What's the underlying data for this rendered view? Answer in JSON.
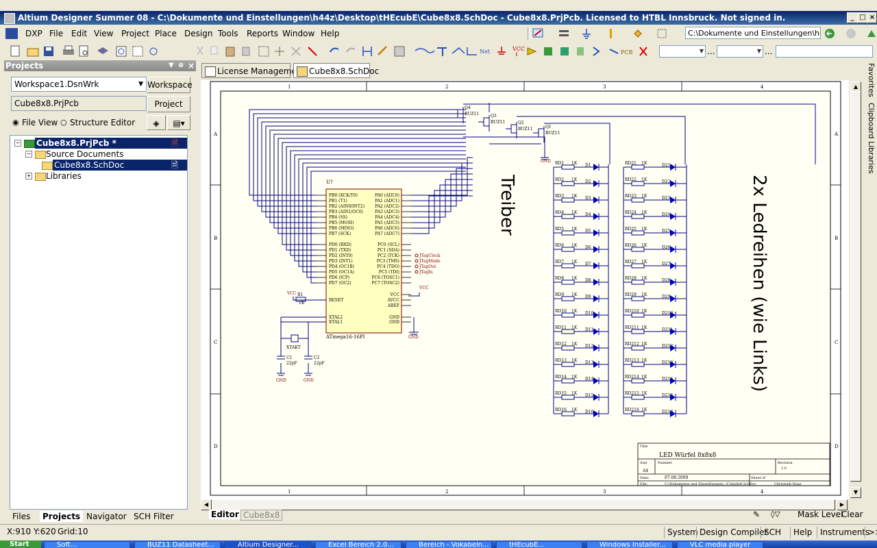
{
  "window": {
    "title": "Altium Designer Summer 08 - C:\\Dokumente und Einstellungen\\h44z\\Desktop\\tHEcubE\\Cube8x8.SchDoc - Cube8x8.PrjPcb. Licensed to HTBL Innsbruck. Not signed in.",
    "min": "_",
    "max": "□",
    "close": "×"
  },
  "menu": [
    "DXP",
    "File",
    "Edit",
    "View",
    "Project",
    "Place",
    "Design",
    "Tools",
    "Reports",
    "Window",
    "Help"
  ],
  "path_combo": "C:\\Dokumente und Einstellungen\\h44z",
  "projects_panel": {
    "title": "Projects",
    "workspace_value": "Workspace1.DsnWrk",
    "workspace_button": "Workspace",
    "project_value": "Cube8x8.PrjPcb",
    "project_button": "Project",
    "radio_file_view": "File View",
    "radio_structure": "Structure Editor",
    "tree": {
      "project": "Cube8x8.PrjPcb *",
      "source_documents": "Source Documents",
      "schdoc": "Cube8x8.SchDoc",
      "libraries": "Libraries"
    }
  },
  "panel_tabs": [
    "Files",
    "Projects",
    "Navigator",
    "SCH Filter"
  ],
  "doc_tabs": [
    "License Management",
    "Cube8x8.SchDoc"
  ],
  "right_strip": [
    "Favorites",
    "Clipboard",
    "Libraries"
  ],
  "editor_tabs": {
    "editor": "Editor",
    "doc": "Cube8x8"
  },
  "mask_level": "Mask Level",
  "clear": "Clear",
  "status": {
    "coords": "X:910 Y:620",
    "grid": "Grid:10",
    "system": "System",
    "design_compiler": "Design Compiler",
    "sch": "SCH",
    "help": "Help",
    "instruments": "Instruments",
    "more": ">>"
  },
  "taskbar": [
    "Start",
    "Soft...",
    "BUZ11 Datasheet...",
    "Altium Designer...",
    "Excel Bereich 2.0...",
    "Bereich - Vokabeln...",
    "tHEcubE...",
    "Windows Installer...",
    "VLC media player"
  ],
  "schematic": {
    "col_labels": [
      "1",
      "2",
      "3",
      "4"
    ],
    "row_labels": [
      "A",
      "B",
      "C",
      "D"
    ],
    "text_treiber": "Treiber",
    "text_ledreihen": "2x Ledreihen (wie Links)",
    "mcu": {
      "designator": "U?",
      "name": "ATmega16-16PI",
      "left_pins": [
        "PB0 (XCK/T0)",
        "PB1 (T1)",
        "PB2 (AIN0/INT2)",
        "PB3 (AIN1/OC0)",
        "PB4 (SS)",
        "PB5 (MOSI)",
        "PB6 (MISO)",
        "PB7 (SCK)",
        "PD0 (RXD)",
        "PD1 (TXD)",
        "PD2 (INT0)",
        "PD3 (INT1)",
        "PD4 (OC1B)",
        "PD5 (OC1A)",
        "PD6 (ICP)",
        "PD7 (OC2)",
        "RESET",
        "XTAL2",
        "XTAL1"
      ],
      "right_pins": [
        "PA0 (ADC0)",
        "PA1 (ADC1)",
        "PA2 (ADC2)",
        "PA3 (ADC3)",
        "PA4 (ADC4)",
        "PA5 (ADC5)",
        "PA6 (ADC6)",
        "PA7 (ADC7)",
        "PC0 (SCL)",
        "PC1 (SDA)",
        "PC2 (TCK)",
        "PC3 (TMS)",
        "PC4 (TDO)",
        "PC5 (TDI)",
        "PC6 (TOSC1)",
        "PC7 (TOSC2)",
        "VCC",
        "AVCC",
        "AREF",
        "GND",
        "GND"
      ],
      "jtag": [
        "JTagClock",
        "JTagMode",
        "JTagOut",
        "JTagIn"
      ]
    },
    "transistors": [
      "Q4",
      "Q3",
      "Q2",
      "Q1"
    ],
    "transistor_type": "BUZ11",
    "vcc": "VCC",
    "gnd": "GND",
    "r1": "R1",
    "r1_val": "1K",
    "xtal": "XTAKT",
    "c1": "C1",
    "c2": "C2",
    "cap_val": "22pF",
    "left_leds": [
      {
        "r": "RD1",
        "d": "D1"
      },
      {
        "r": "RD2",
        "d": "D2"
      },
      {
        "r": "RD3",
        "d": "D3"
      },
      {
        "r": "RD4",
        "d": "D4"
      },
      {
        "r": "RD5",
        "d": "D5"
      },
      {
        "r": "RD6",
        "d": "D6"
      },
      {
        "r": "RD7",
        "d": "D7"
      },
      {
        "r": "RD8",
        "d": "D8"
      },
      {
        "r": "RD9",
        "d": "D9"
      },
      {
        "r": "RD10",
        "d": "D10"
      },
      {
        "r": "RD11",
        "d": "D11"
      },
      {
        "r": "RD12",
        "d": "D12"
      },
      {
        "r": "RD13",
        "d": "D13"
      },
      {
        "r": "RD14",
        "d": "D14"
      },
      {
        "r": "RD15",
        "d": "D15"
      },
      {
        "r": "RD16",
        "d": "D16"
      }
    ],
    "right_leds": [
      {
        "r": "RD21",
        "d": "D21"
      },
      {
        "r": "RD22",
        "d": "D22"
      },
      {
        "r": "RD23",
        "d": "D23"
      },
      {
        "r": "RD24",
        "d": "D24"
      },
      {
        "r": "RD25",
        "d": "D25"
      },
      {
        "r": "RD26",
        "d": "D26"
      },
      {
        "r": "RD27",
        "d": "D27"
      },
      {
        "r": "RD28",
        "d": "D28"
      },
      {
        "r": "RD29",
        "d": "D29"
      },
      {
        "r": "RD210",
        "d": "D210"
      },
      {
        "r": "RD211",
        "d": "D211"
      },
      {
        "r": "RD212",
        "d": "D212"
      },
      {
        "r": "RD213",
        "d": "D213"
      },
      {
        "r": "RD214",
        "d": "D214"
      },
      {
        "r": "RD215",
        "d": "D215"
      },
      {
        "r": "RD216",
        "d": "D216"
      }
    ],
    "res_val": "1K",
    "title_block": {
      "title_label": "Title",
      "title": "LED Würfel 8x8x8",
      "size_label": "Size",
      "size": "A4",
      "number_label": "Number",
      "revision_label": "Revision",
      "revision": "1.0",
      "date_label": "Date:",
      "date": "07.08.2009",
      "sheet_label": "Sheet   of",
      "file_label": "File:",
      "file": "C:\\Dokumente und Einstellungen\\..\\Cube8x8.SchDoc",
      "drawn": "Christoph Haas"
    }
  }
}
